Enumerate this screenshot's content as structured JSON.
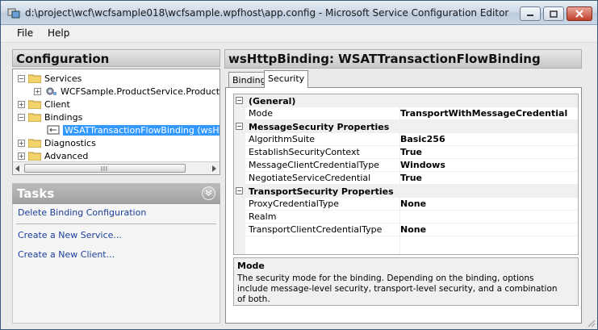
{
  "window": {
    "title": "d:\\project\\wcf\\wcfsample018\\wcfsample.wpfhost\\app.config - Microsoft Service Configuration Editor"
  },
  "menu": {
    "file": "File",
    "help": "Help"
  },
  "config_panel": {
    "title": "Configuration",
    "tree": [
      {
        "label": "Services",
        "expander": "−"
      },
      {
        "label": "WCFSample.ProductService.ProductService",
        "expander": "+"
      },
      {
        "label": "Client",
        "expander": "+"
      },
      {
        "label": "Bindings",
        "expander": "−"
      },
      {
        "label": "WSATTransactionFlowBinding (wsHttpBinding)",
        "selected": true
      },
      {
        "label": "Diagnostics",
        "expander": "+"
      },
      {
        "label": "Advanced",
        "expander": "+"
      }
    ]
  },
  "tasks_panel": {
    "title": "Tasks",
    "links": [
      "Delete Binding Configuration",
      "Create a New Service...",
      "Create a New Client..."
    ]
  },
  "details": {
    "title": "wsHttpBinding: WSATTransactionFlowBinding",
    "tabs": [
      "Binding",
      "Security"
    ],
    "active_tab": "Security",
    "categories": [
      {
        "name": "(General)",
        "props": [
          {
            "name": "Mode",
            "value": "TransportWithMessageCredential"
          }
        ]
      },
      {
        "name": "MessageSecurity Properties",
        "props": [
          {
            "name": "AlgorithmSuite",
            "value": "Basic256"
          },
          {
            "name": "EstablishSecurityContext",
            "value": "True"
          },
          {
            "name": "MessageClientCredentialType",
            "value": "Windows"
          },
          {
            "name": "NegotiateServiceCredential",
            "value": "True"
          }
        ]
      },
      {
        "name": "TransportSecurity Properties",
        "props": [
          {
            "name": "ProxyCredentialType",
            "value": "None"
          },
          {
            "name": "Realm",
            "value": ""
          },
          {
            "name": "TransportClientCredentialType",
            "value": "None"
          }
        ]
      }
    ],
    "help": {
      "title": "Mode",
      "description": "The security mode for the binding. Depending on the binding, options include message-level security, transport-level security, and a combination of both."
    }
  },
  "colors": {
    "selection": "#3399ff",
    "link": "#1a3e9c"
  }
}
